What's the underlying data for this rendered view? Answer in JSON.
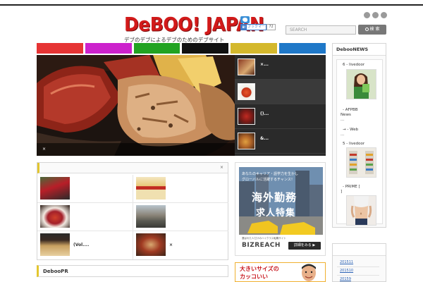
{
  "site": {
    "title": "DeBOO! JAPAN",
    "tagline": "デブのデブによるデブのためのデブサイト"
  },
  "share": {
    "hatebu_label": "ブックマーク",
    "hatebu_count": "72"
  },
  "social_icons": [
    "rss-icon",
    "twitter-icon",
    "facebook-icon"
  ],
  "search": {
    "placeholder": "SEARCH",
    "button_label": "検 索"
  },
  "category_colors": [
    "#e63434",
    "#cc22cc",
    "#22a322",
    "#111111",
    "#d4b82c",
    "#1f78c8"
  ],
  "featured": {
    "caption": "×",
    "items": [
      {
        "label": "×..."
      },
      {
        "label": ""
      },
      {
        "label": "()..."
      },
      {
        "label": "&..."
      }
    ]
  },
  "panel": {
    "close": "×",
    "cells": [
      {
        "label": ""
      },
      {
        "label": ""
      },
      {
        "label": ""
      },
      {
        "label": ""
      },
      {
        "label": "(Vol...."
      },
      {
        "label": "×"
      }
    ]
  },
  "ad": {
    "line1": "あなたのキャリア・語学力を生かし",
    "line2": "グローバルに活躍するチャンス！",
    "headline1": "海外勤務",
    "headline2": "求人特集",
    "brand": "BIZREACH",
    "brand_sub": "選ばれた人だけのハイクラス転職サイト",
    "cta": "詳細をみる ▶"
  },
  "ad2": {
    "line1": "大きいサイズの",
    "line2": "カッコいい"
  },
  "pr": {
    "title": "DebooPR"
  },
  "news": {
    "title": "DebooNEWS",
    "items": [
      {
        "source": "6 - livedoor"
      },
      {
        "source": "- AFPBB",
        "extra": "News",
        "dots": "..."
      },
      {
        "source": "→ - Web",
        "dots": "..."
      },
      {
        "source": "5 - livedoor"
      },
      {
        "source": "- PRIME [",
        "extra": "]"
      }
    ]
  },
  "archive": {
    "items": [
      "201511",
      "201510",
      "20159"
    ]
  }
}
